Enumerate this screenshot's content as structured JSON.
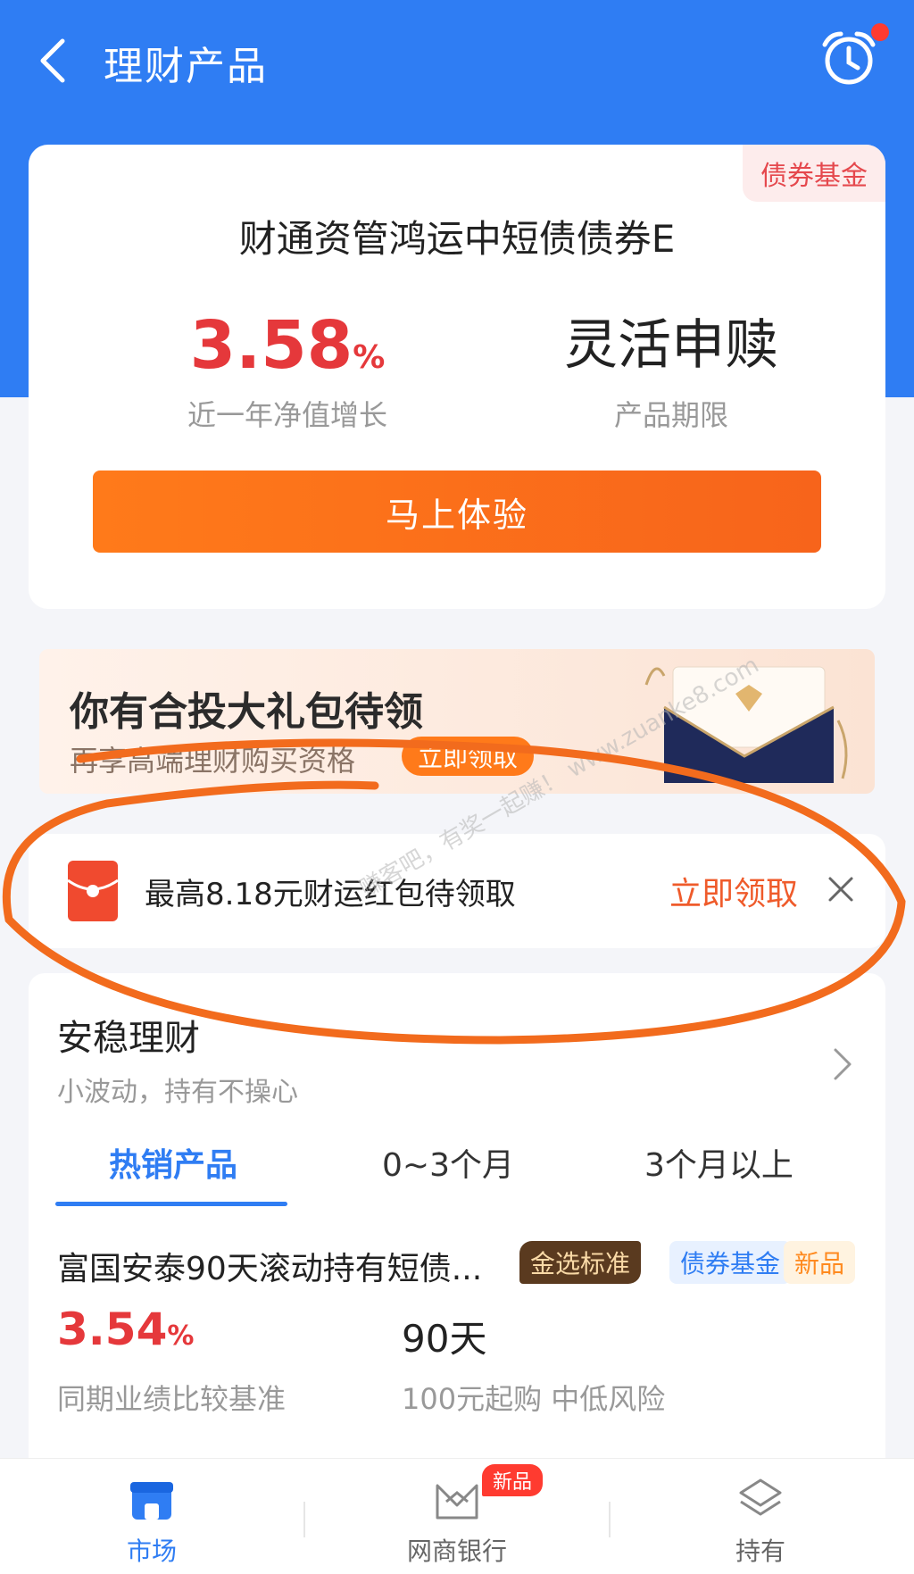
{
  "header": {
    "title": "理财产品"
  },
  "product_card": {
    "tag": "债券基金",
    "name": "财通资管鸿运中短债债券E",
    "rate_value": "3.58",
    "rate_unit": "%",
    "rate_label": "近一年净值增长",
    "term_value": "灵活申赎",
    "term_label": "产品期限",
    "cta_label": "马上体验"
  },
  "banner": {
    "title": "你有合投大礼包待领",
    "subtitle": "再享高端理财购买资格",
    "pill": "立即领取"
  },
  "notice": {
    "text": "最高8.18元财运红包待领取",
    "action": "立即领取"
  },
  "section": {
    "title": "安稳理财",
    "subtitle": "小波动，持有不操心",
    "tabs": [
      {
        "label": "热销产品",
        "active": true
      },
      {
        "label": "0~3个月",
        "active": false
      },
      {
        "label": "3个月以上",
        "active": false
      }
    ],
    "item": {
      "name": "富国安泰90天滚动持有短债...",
      "badges": [
        "金选标准",
        "债券基金",
        "新品"
      ],
      "rate_value": "3.54",
      "rate_unit": "%",
      "rate_label": "同期业绩比较基准",
      "term_value": "90天",
      "term_label": "100元起购 中低风险"
    }
  },
  "tabbar": {
    "items": [
      {
        "label": "市场",
        "icon": "shop-icon",
        "active": true
      },
      {
        "label": "网商银行",
        "icon": "bank-icon",
        "active": false
      },
      {
        "label": "持有",
        "icon": "layers-icon",
        "active": false
      }
    ],
    "new_badge": "新品"
  },
  "watermark": "赚客吧，有奖一起赚！ www.zuanke8.com",
  "colors": {
    "brand_blue": "#2f7df3",
    "rate_red": "#e5383b",
    "cta_orange": "#f7641b",
    "annotation_orange": "#f26b1d"
  }
}
